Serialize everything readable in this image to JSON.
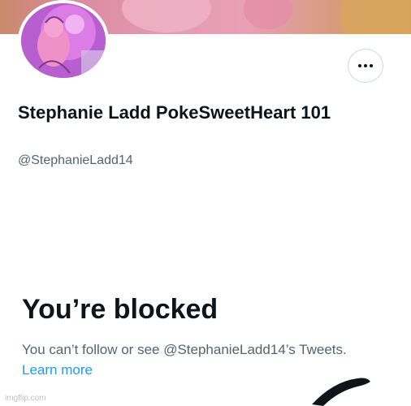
{
  "profile": {
    "display_name": "Stephanie Ladd PokeSweetHeart 101",
    "handle": "@StephanieLadd14",
    "more_button_icon": "more-horizontal-icon"
  },
  "blocked": {
    "title": "You’re blocked",
    "message": "You can’t follow or see @StephanieLadd14’s Tweets.",
    "learn_more": "Learn more"
  },
  "watermark": "imgflip.com",
  "colors": {
    "primary_text": "#0f1419",
    "secondary_text": "#536471",
    "link": "#1d9bf0",
    "border": "#cfd9de"
  }
}
